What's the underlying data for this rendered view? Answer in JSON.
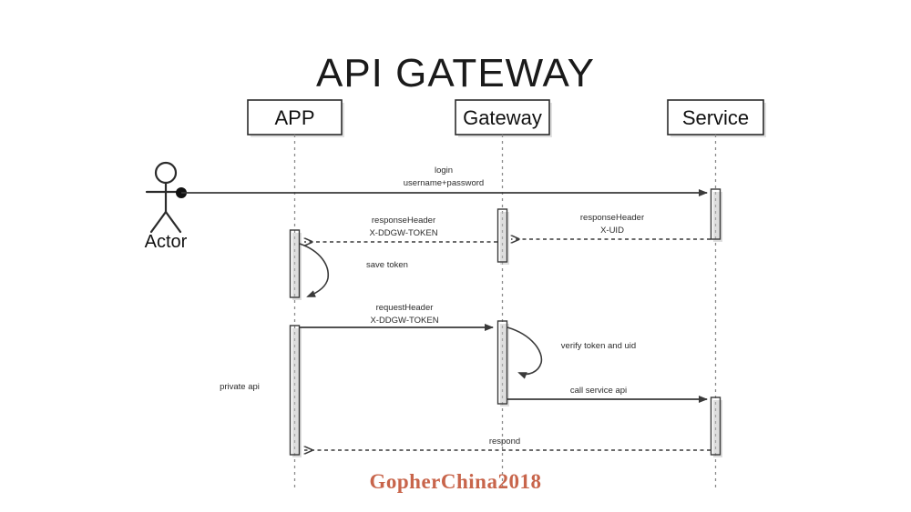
{
  "diagram": {
    "title": "API GATEWAY",
    "type": "uml-sequence-diagram",
    "watermark": "GopherChina2018",
    "colors": {
      "background": "#ffffff",
      "line": "#3a3a3a",
      "lifeline": "#8c8c8c",
      "text": "#1a1a1a",
      "watermark": "#c8654b"
    },
    "actor": {
      "name": "Actor",
      "icon": "stick-figure-icon"
    },
    "participants": [
      {
        "id": "app",
        "label": "APP"
      },
      {
        "id": "gateway",
        "label": "Gateway"
      },
      {
        "id": "service",
        "label": "Service"
      }
    ],
    "messages": [
      {
        "id": "m1",
        "from": "actor",
        "to": "service",
        "style": "solid",
        "lines": [
          "login",
          "username+password"
        ]
      },
      {
        "id": "m2",
        "from": "service",
        "to": "gateway",
        "style": "dashed",
        "lines": [
          "responseHeader",
          "X-UID"
        ]
      },
      {
        "id": "m3",
        "from": "gateway",
        "to": "app",
        "style": "dashed",
        "lines": [
          "responseHeader",
          "X-DDGW-TOKEN"
        ]
      },
      {
        "id": "m4",
        "from": "app",
        "to": "app",
        "style": "self",
        "lines": [
          "save token"
        ]
      },
      {
        "id": "m5",
        "from": "app",
        "to": "gateway",
        "style": "solid",
        "lines": [
          "requestHeader",
          "X-DDGW-TOKEN"
        ]
      },
      {
        "id": "m6",
        "from": "gateway",
        "to": "gateway",
        "style": "self",
        "lines": [
          "verify token and uid"
        ]
      },
      {
        "id": "m7",
        "from": "gateway",
        "to": "service",
        "style": "solid",
        "lines": [
          "call service api"
        ]
      },
      {
        "id": "m8",
        "from": "service",
        "to": "app",
        "style": "dashed",
        "lines": [
          "respond"
        ]
      }
    ],
    "notes": [
      {
        "id": "n1",
        "text": "private api"
      }
    ]
  }
}
